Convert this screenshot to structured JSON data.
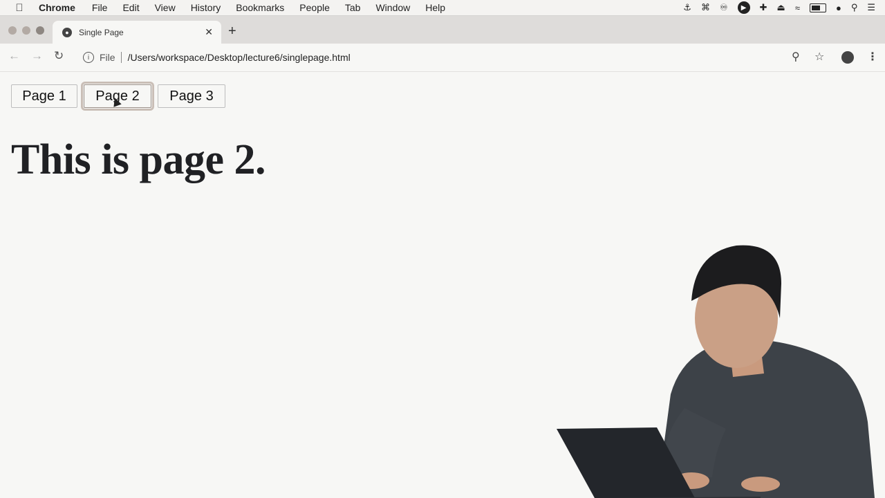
{
  "menubar": {
    "items": [
      "Chrome",
      "File",
      "Edit",
      "View",
      "History",
      "Bookmarks",
      "People",
      "Tab",
      "Window",
      "Help"
    ]
  },
  "browser": {
    "tab_title": "Single Page",
    "url_scheme_label": "File",
    "url": "/Users/workspace/Desktop/lecture6/singlepage.html"
  },
  "page": {
    "buttons": [
      "Page 1",
      "Page 2",
      "Page 3"
    ],
    "heading": "This is page 2."
  },
  "colors": {
    "background": "#f7f7f5",
    "heading": "#202124"
  }
}
